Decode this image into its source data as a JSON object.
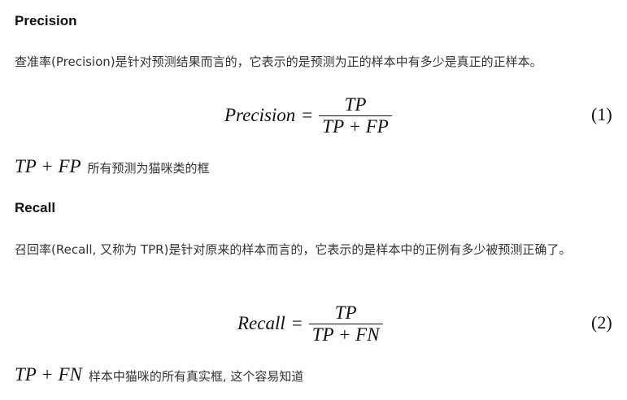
{
  "sections": {
    "precision": {
      "heading": "Precision",
      "description": "查准率(Precision)是针对预测结果而言的，它表示的是预测为正的样本中有多少是真正的正样本。",
      "equation": {
        "lhs": "Precision",
        "equals": "=",
        "numerator": "TP",
        "denominator": "TP + FP",
        "number": "(1)"
      },
      "note": {
        "expression": "TP + FP",
        "text": "所有预测为猫咪类的框"
      }
    },
    "recall": {
      "heading": "Recall",
      "description": "召回率(Recall, 又称为 TPR)是针对原来的样本而言的，它表示的是样本中的正例有多少被预测正确了。",
      "equation": {
        "lhs": "Recall",
        "equals": "=",
        "numerator": "TP",
        "denominator": "TP + FN",
        "number": "(2)"
      },
      "note": {
        "expression": "TP + FN",
        "text": "样本中猫咪的所有真实框, 这个容易知道"
      }
    }
  }
}
